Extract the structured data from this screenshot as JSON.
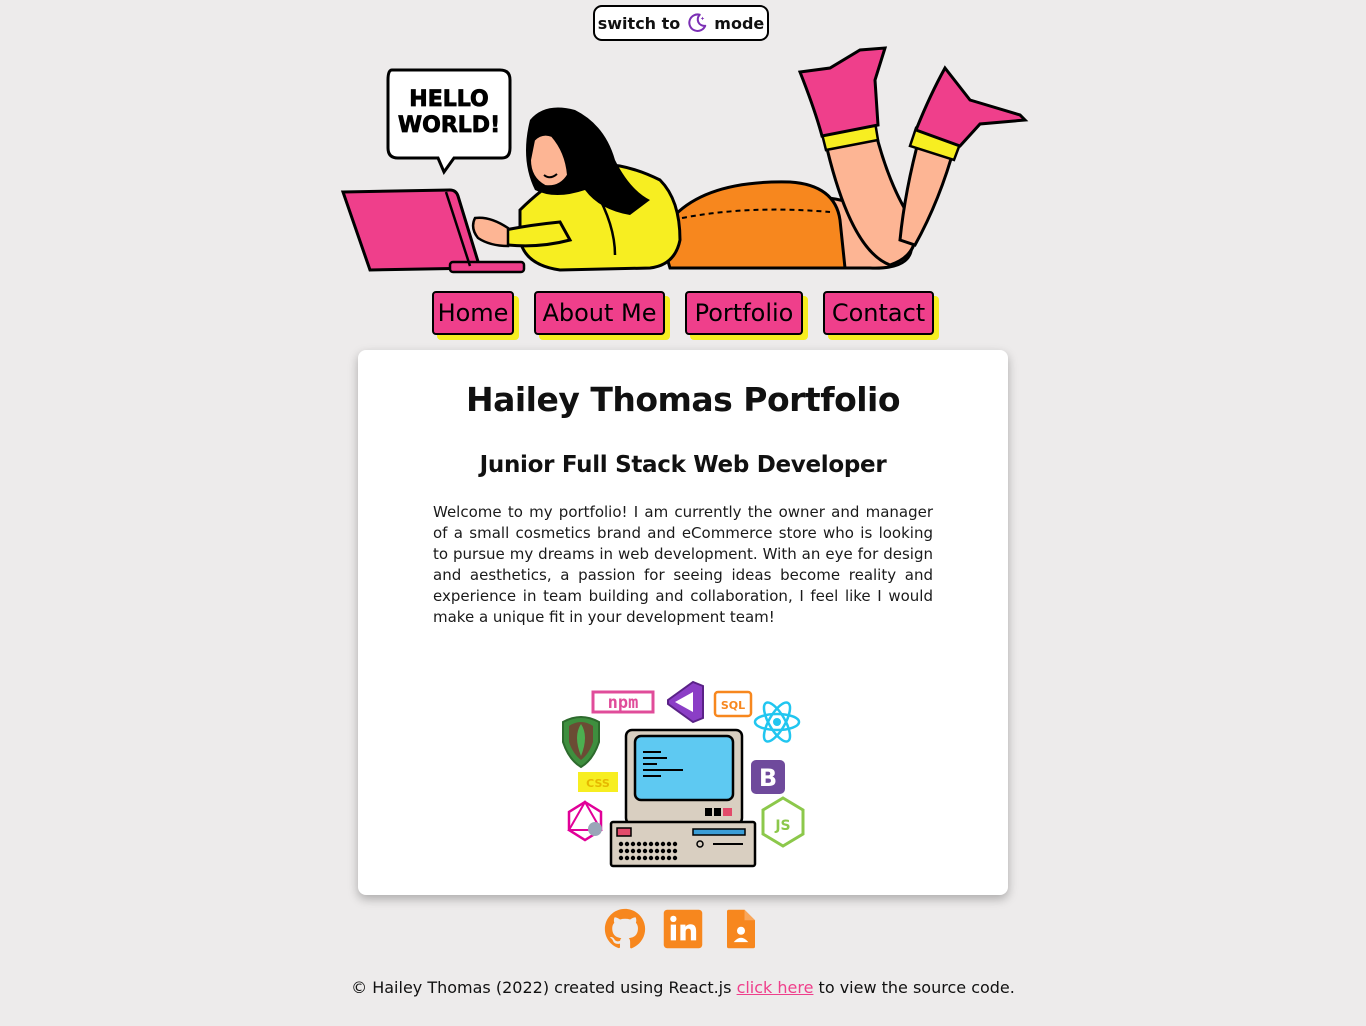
{
  "mode_toggle": {
    "prefix": "switch to",
    "icon": "moon-icon",
    "suffix": "mode"
  },
  "hero": {
    "speech_bubble": "HELLO WORLD!"
  },
  "nav": {
    "items": [
      {
        "label": "Home"
      },
      {
        "label": "About Me"
      },
      {
        "label": "Portfolio"
      },
      {
        "label": "Contact"
      }
    ]
  },
  "main": {
    "title": "Hailey Thomas Portfolio",
    "subtitle": "Junior Full Stack Web Developer",
    "intro": "Welcome to my portfolio! I am currently the owner and manager of a small cosmetics brand and eCommerce store who is looking to pursue my dreams in web development. With an eye for design and aesthetics, a passion for seeing ideas become reality and experience in team building and collaboration, I feel like I would make a unique fit in your development team!",
    "tech_labels": {
      "npm": "npm",
      "sql": "SQL",
      "css": "CSS",
      "bootstrap": "B",
      "js": "JS"
    }
  },
  "socials": [
    {
      "icon": "github-icon"
    },
    {
      "icon": "linkedin-icon"
    },
    {
      "icon": "resume-file-icon"
    }
  ],
  "footer": {
    "prefix": "© Hailey Thomas (2022) created using React.js",
    "link": "click here",
    "suffix": "to view the source code."
  },
  "colors": {
    "background": "#edebeb",
    "pink": "#ef3f8b",
    "yellow": "#f7ee21",
    "orange": "#f7871e",
    "purple": "#7b2fb5"
  }
}
